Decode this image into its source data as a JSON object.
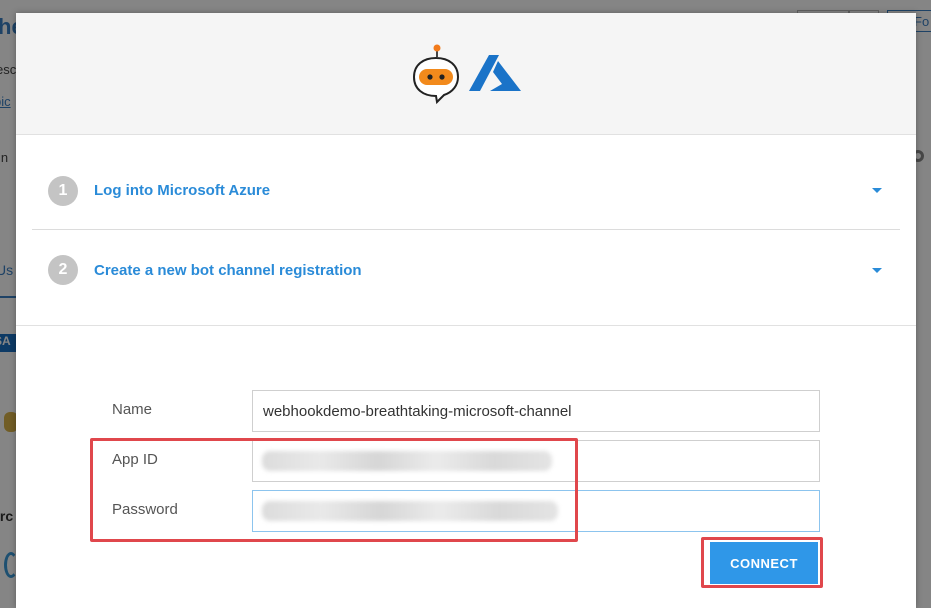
{
  "background": {
    "title_fragment": "he",
    "desc_fragment": "esc",
    "link_fragment": "pic",
    "label_fragment": "in",
    "tab_fragment": "Us",
    "logo_text": "SA",
    "section_fragment": "irc",
    "button_fragment": "Fo"
  },
  "modal": {
    "icons": [
      "bot-icon",
      "azure-icon"
    ],
    "steps": [
      {
        "number": "1",
        "title": "Log into Microsoft Azure"
      },
      {
        "number": "2",
        "title": "Create a new bot channel registration"
      }
    ],
    "fields": {
      "name": {
        "label": "Name",
        "value": "webhookdemo-breathtaking-microsoft-channel"
      },
      "app_id": {
        "label": "App ID",
        "value": ""
      },
      "password": {
        "label": "Password",
        "value": ""
      }
    },
    "connect_label": "CONNECT"
  },
  "colors": {
    "accent": "#2a8bd8",
    "button": "#2f97e8",
    "highlight": "#e0474c",
    "azure": "#1a73c8",
    "bot": "#f28a1c"
  }
}
